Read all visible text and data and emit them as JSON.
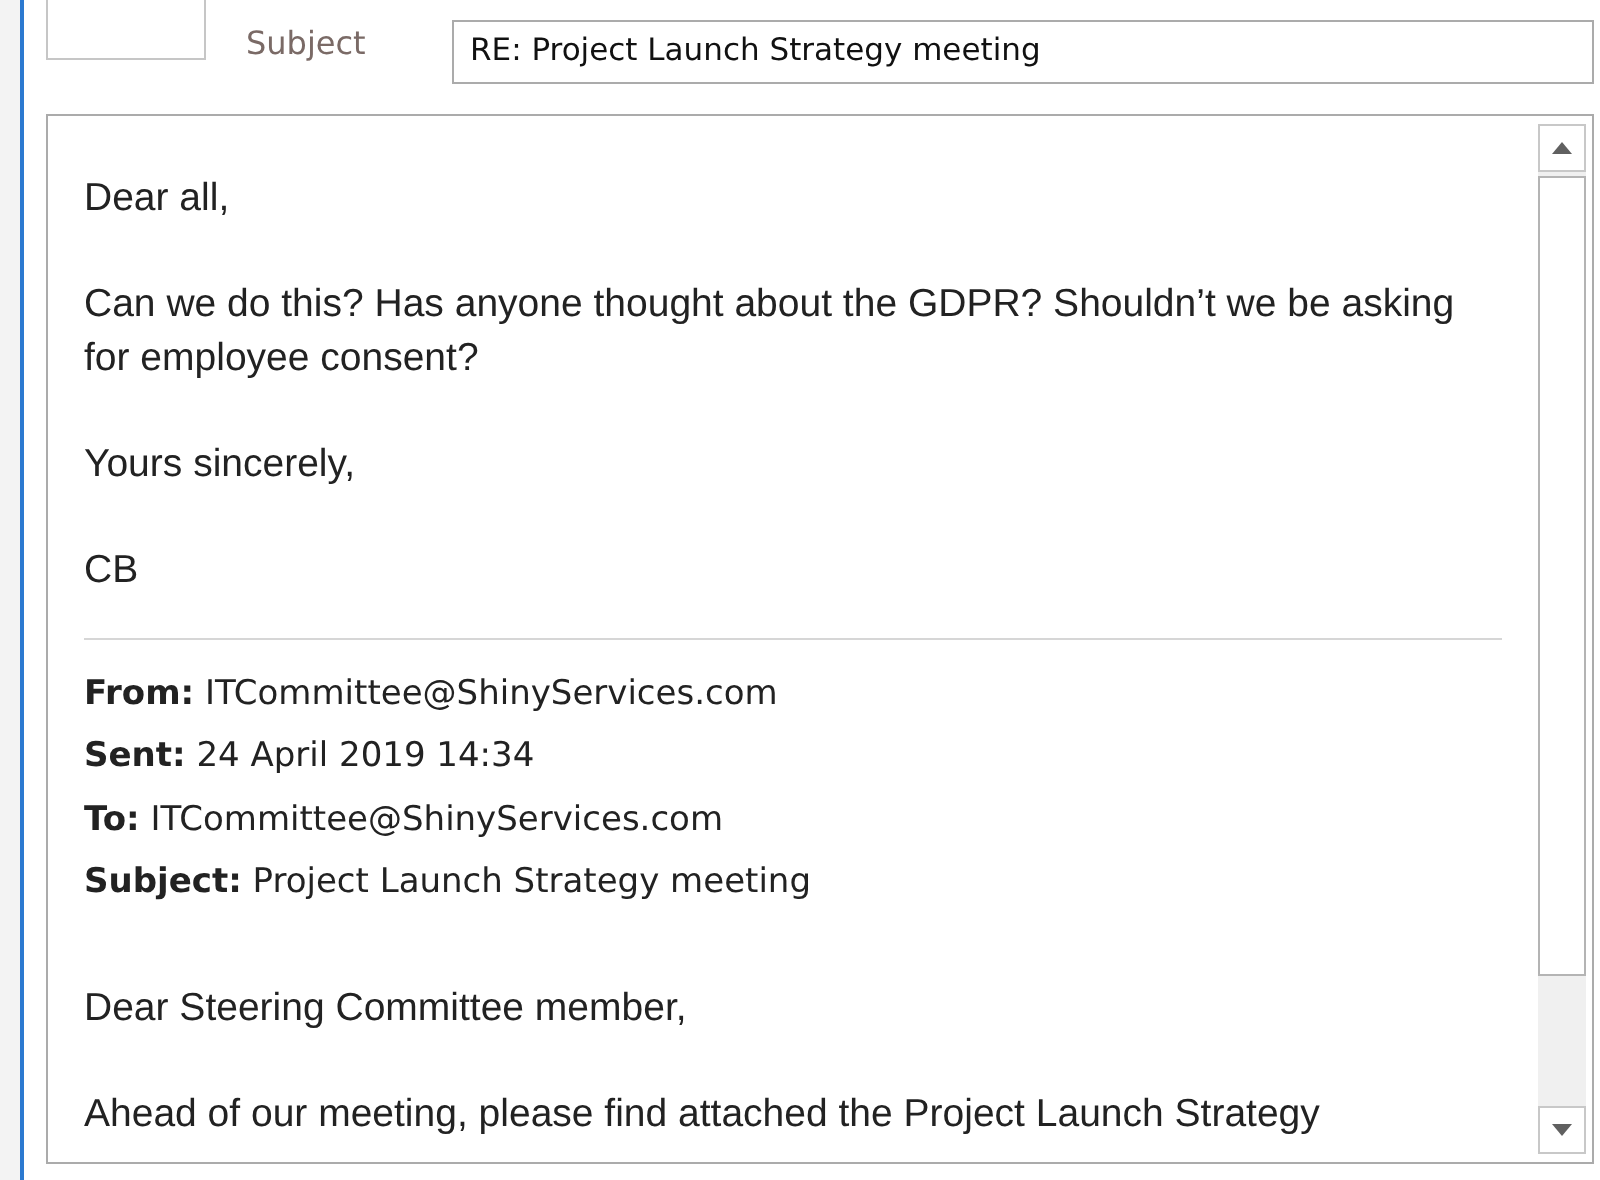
{
  "subject": {
    "label": "Subject",
    "value": "RE: Project Launch Strategy meeting"
  },
  "reply": [
    "Dear all,",
    "Can we do this? Has anyone thought about the GDPR? Shouldn’t we be asking for employee consent?",
    "Yours sincerely,",
    "CB"
  ],
  "quoted_header": [
    "**From:** ITCommittee@ShinyServices.com",
    "**Sent:** 24 April 2019 14:34",
    "**To:** ITCommittee@ShinyServices.com",
    "**Subject:** Project Launch Strategy meeting"
  ],
  "quoted_body": [
    "Dear Steering Committee member,",
    "Ahead of our meeting, please find attached the Project Launch Strategy"
  ]
}
